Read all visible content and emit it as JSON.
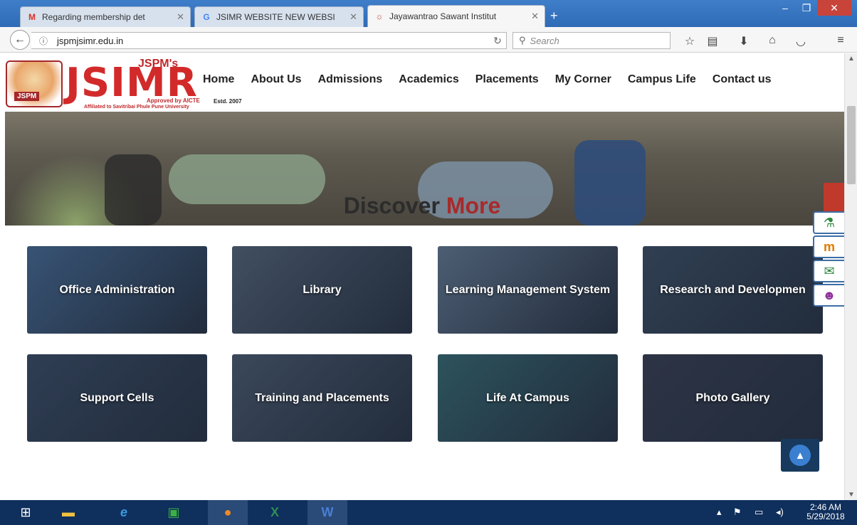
{
  "browser": {
    "tabs": [
      {
        "title": "Regarding membership det",
        "icon": "gmail-icon",
        "active": false
      },
      {
        "title": "JSIMR WEBSITE NEW WEBSI",
        "icon": "google-icon",
        "active": false
      },
      {
        "title": "Jayawantrao Sawant Institut",
        "icon": "site-icon",
        "active": true
      }
    ],
    "new_tab": "+",
    "url": "jspmjsimr.edu.in",
    "search_placeholder": "Search"
  },
  "header": {
    "logo": {
      "top_text": "JSPM's",
      "big_text": "JSIMR",
      "approved": "Approved by AICTE",
      "estd": "Estd. 2007",
      "affiliation": "Affiliated to Savitribai Phule Pune University",
      "emblem_text": "JSPM"
    },
    "menu": [
      "Home",
      "About Us",
      "Admissions",
      "Academics",
      "Placements",
      "My Corner",
      "Campus Life",
      "Contact us"
    ]
  },
  "discover": {
    "title_main": "Discover",
    "title_accent": "More"
  },
  "cards": [
    {
      "label": "Office Administration",
      "color": "#4b6b8f"
    },
    {
      "label": "Library",
      "color": "#5a6470"
    },
    {
      "label": "Learning Management System",
      "color": "#6b7b8c"
    },
    {
      "label": "Research and Developmen",
      "color": "#3f4c5a"
    },
    {
      "label": "Support Cells",
      "color": "#3e4a5c"
    },
    {
      "label": "Training and Placements",
      "color": "#505a66"
    },
    {
      "label": "Life At Campus",
      "color": "#3a6a6a"
    },
    {
      "label": "Photo Gallery",
      "color": "#3b3a45"
    }
  ],
  "side_icons": [
    {
      "name": "microscope-icon",
      "glyph": "⚗",
      "color": "#2b8a3e"
    },
    {
      "name": "m-icon",
      "glyph": "m",
      "color": "#e07b00"
    },
    {
      "name": "document-icon",
      "glyph": "✉",
      "color": "#2b8a3e"
    },
    {
      "name": "person-icon",
      "glyph": "☻",
      "color": "#8e2f9a"
    }
  ],
  "taskbar": {
    "time": "2:46 AM",
    "date": "5/29/2018"
  }
}
